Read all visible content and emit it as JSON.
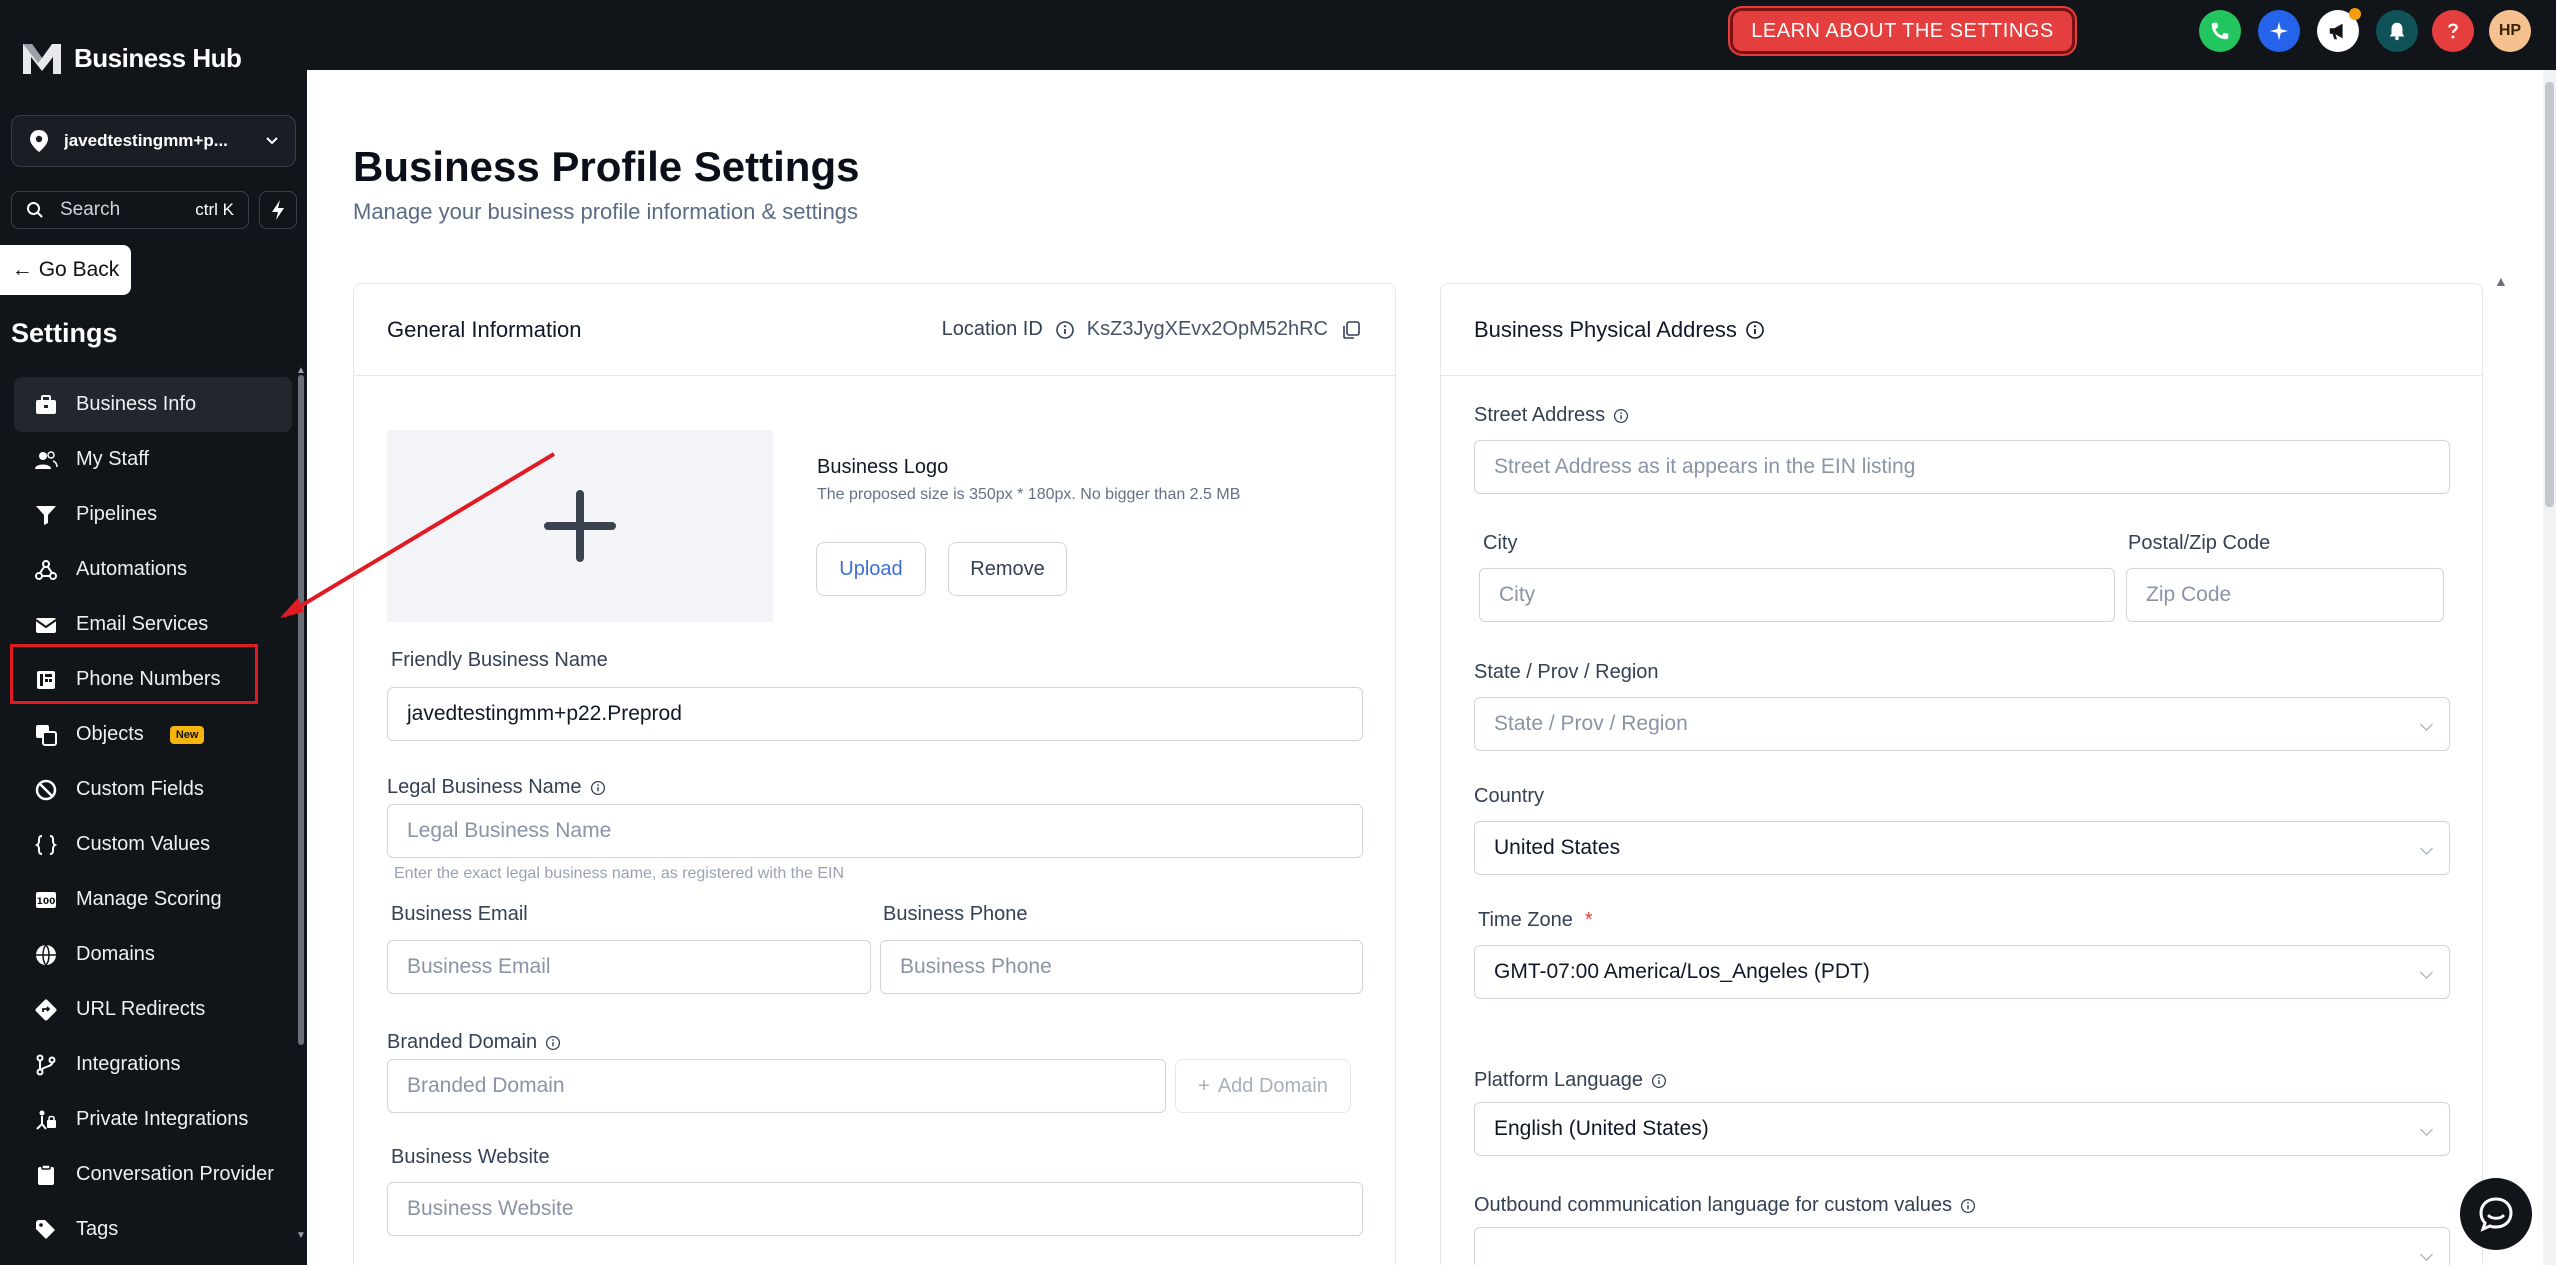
{
  "brand": {
    "name": "Business Hub"
  },
  "sidebar": {
    "location_name": "javedtestingmm+p...",
    "search_label": "Search",
    "search_shortcut": "ctrl K",
    "go_back": "Go Back",
    "title": "Settings",
    "items": [
      {
        "label": "Business Info",
        "icon": "briefcase-icon"
      },
      {
        "label": "My Staff",
        "icon": "users-icon"
      },
      {
        "label": "Pipelines",
        "icon": "filter-icon"
      },
      {
        "label": "Automations",
        "icon": "automation-icon"
      },
      {
        "label": "Email Services",
        "icon": "email-icon"
      },
      {
        "label": "Phone Numbers",
        "icon": "phone-book-icon"
      },
      {
        "label": "Objects",
        "icon": "objects-icon",
        "badge": "New"
      },
      {
        "label": "Custom Fields",
        "icon": "custom-fields-icon"
      },
      {
        "label": "Custom Values",
        "icon": "braces-icon"
      },
      {
        "label": "Manage Scoring",
        "icon": "scoring-icon"
      },
      {
        "label": "Domains",
        "icon": "globe-icon"
      },
      {
        "label": "URL Redirects",
        "icon": "redirect-icon"
      },
      {
        "label": "Integrations",
        "icon": "integrations-icon"
      },
      {
        "label": "Private Integrations",
        "icon": "private-integrations-icon"
      },
      {
        "label": "Conversation Provider",
        "icon": "clipboard-icon"
      },
      {
        "label": "Tags",
        "icon": "tag-icon"
      }
    ]
  },
  "topbar": {
    "learn_button": "LEARN ABOUT THE SETTINGS",
    "avatar_initials": "HP"
  },
  "page": {
    "title": "Business Profile Settings",
    "subtitle": "Manage your business profile information & settings"
  },
  "general": {
    "title": "General Information",
    "location_id_label": "Location ID",
    "location_id_value": "KsZ3JygXEvx2OpM52hRC",
    "logo_title": "Business Logo",
    "logo_hint": "The proposed size is 350px * 180px. No bigger than 2.5 MB",
    "upload": "Upload",
    "remove": "Remove",
    "friendly_name_label": "Friendly Business Name",
    "friendly_name_value": "javedtestingmm+p22.Preprod",
    "legal_name_label": "Legal Business Name",
    "legal_name_placeholder": "Legal Business Name",
    "legal_name_hint": "Enter the exact legal business name, as registered with the EIN",
    "email_label": "Business Email",
    "email_placeholder": "Business Email",
    "phone_label": "Business Phone",
    "phone_placeholder": "Business Phone",
    "branded_domain_label": "Branded Domain",
    "branded_domain_placeholder": "Branded Domain",
    "add_domain": "Add Domain",
    "website_label": "Business Website",
    "website_placeholder": "Business Website"
  },
  "address": {
    "title": "Business Physical Address",
    "street_label": "Street Address",
    "street_placeholder": "Street Address as it appears in the EIN listing",
    "city_label": "City",
    "city_placeholder": "City",
    "zip_label": "Postal/Zip Code",
    "zip_placeholder": "Zip Code",
    "state_label": "State / Prov / Region",
    "state_placeholder": "State / Prov / Region",
    "country_label": "Country",
    "country_value": "United States",
    "timezone_label": "Time Zone",
    "timezone_required": "*",
    "timezone_value": "GMT-07:00 America/Los_Angeles (PDT)",
    "platform_language_label": "Platform Language",
    "platform_language_value": "English (United States)",
    "outbound_language_label": "Outbound communication language for custom values"
  }
}
